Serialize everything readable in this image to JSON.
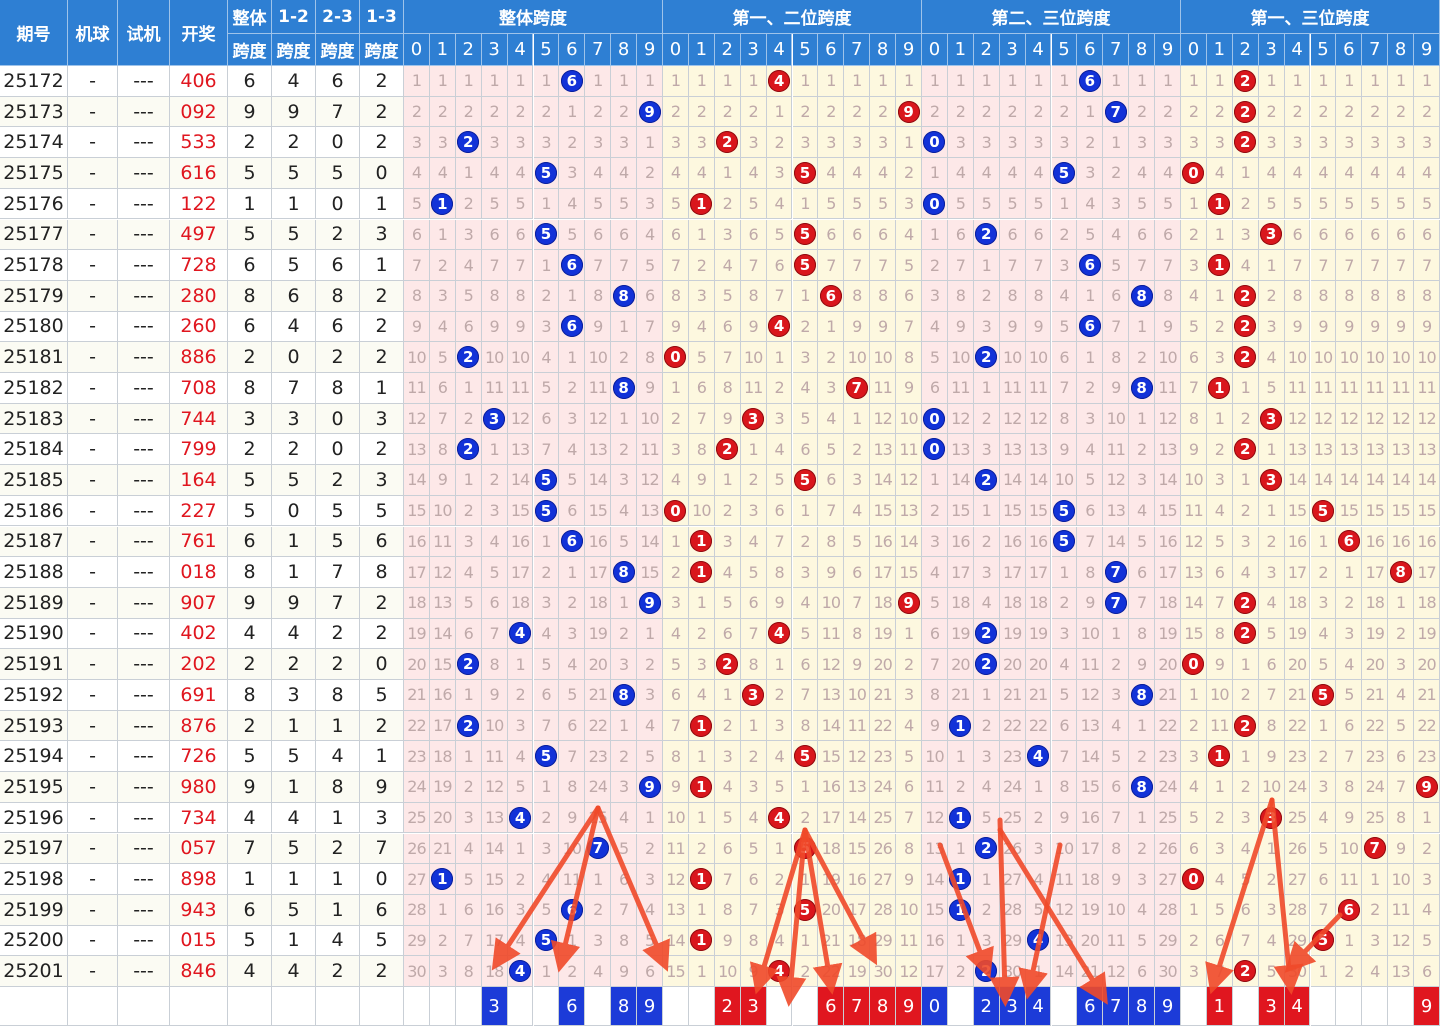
{
  "headers": {
    "issue": "期号",
    "machine": "机球",
    "trial": "试机",
    "draw": "开奖",
    "span_all": [
      "整体",
      "跨度"
    ],
    "span_12": [
      "1-2",
      "跨度"
    ],
    "span_23": [
      "2-3",
      "跨度"
    ],
    "span_13": [
      "1-3",
      "跨度"
    ],
    "groups": [
      "整体跨度",
      "第一、二位跨度",
      "第二、三位跨度",
      "第一、三位跨度"
    ],
    "digits": [
      "0",
      "1",
      "2",
      "3",
      "4",
      "5",
      "6",
      "7",
      "8",
      "9"
    ]
  },
  "colors": {
    "blue": "#1232d8",
    "red": "#d9161c",
    "header": "#2e7fd3",
    "arrow": "#f04a2a"
  },
  "chart_data": {
    "type": "table",
    "rows": [
      {
        "issue": "25172",
        "machine": "-",
        "trial": "---",
        "draw": "406",
        "span_all": 6,
        "span_12": 4,
        "span_23": 6,
        "span_13": 2
      },
      {
        "issue": "25173",
        "machine": "-",
        "trial": "---",
        "draw": "092",
        "span_all": 9,
        "span_12": 9,
        "span_23": 7,
        "span_13": 2
      },
      {
        "issue": "25174",
        "machine": "-",
        "trial": "---",
        "draw": "533",
        "span_all": 2,
        "span_12": 2,
        "span_23": 0,
        "span_13": 2
      },
      {
        "issue": "25175",
        "machine": "-",
        "trial": "---",
        "draw": "616",
        "span_all": 5,
        "span_12": 5,
        "span_23": 5,
        "span_13": 0
      },
      {
        "issue": "25176",
        "machine": "-",
        "trial": "---",
        "draw": "122",
        "span_all": 1,
        "span_12": 1,
        "span_23": 0,
        "span_13": 1
      },
      {
        "issue": "25177",
        "machine": "-",
        "trial": "---",
        "draw": "497",
        "span_all": 5,
        "span_12": 5,
        "span_23": 2,
        "span_13": 3
      },
      {
        "issue": "25178",
        "machine": "-",
        "trial": "---",
        "draw": "728",
        "span_all": 6,
        "span_12": 5,
        "span_23": 6,
        "span_13": 1
      },
      {
        "issue": "25179",
        "machine": "-",
        "trial": "---",
        "draw": "280",
        "span_all": 8,
        "span_12": 6,
        "span_23": 8,
        "span_13": 2
      },
      {
        "issue": "25180",
        "machine": "-",
        "trial": "---",
        "draw": "260",
        "span_all": 6,
        "span_12": 4,
        "span_23": 6,
        "span_13": 2
      },
      {
        "issue": "25181",
        "machine": "-",
        "trial": "---",
        "draw": "886",
        "span_all": 2,
        "span_12": 0,
        "span_23": 2,
        "span_13": 2
      },
      {
        "issue": "25182",
        "machine": "-",
        "trial": "---",
        "draw": "708",
        "span_all": 8,
        "span_12": 7,
        "span_23": 8,
        "span_13": 1
      },
      {
        "issue": "25183",
        "machine": "-",
        "trial": "---",
        "draw": "744",
        "span_all": 3,
        "span_12": 3,
        "span_23": 0,
        "span_13": 3
      },
      {
        "issue": "25184",
        "machine": "-",
        "trial": "---",
        "draw": "799",
        "span_all": 2,
        "span_12": 2,
        "span_23": 0,
        "span_13": 2
      },
      {
        "issue": "25185",
        "machine": "-",
        "trial": "---",
        "draw": "164",
        "span_all": 5,
        "span_12": 5,
        "span_23": 2,
        "span_13": 3
      },
      {
        "issue": "25186",
        "machine": "-",
        "trial": "---",
        "draw": "227",
        "span_all": 5,
        "span_12": 0,
        "span_23": 5,
        "span_13": 5
      },
      {
        "issue": "25187",
        "machine": "-",
        "trial": "---",
        "draw": "761",
        "span_all": 6,
        "span_12": 1,
        "span_23": 5,
        "span_13": 6
      },
      {
        "issue": "25188",
        "machine": "-",
        "trial": "---",
        "draw": "018",
        "span_all": 8,
        "span_12": 1,
        "span_23": 7,
        "span_13": 8
      },
      {
        "issue": "25189",
        "machine": "-",
        "trial": "---",
        "draw": "907",
        "span_all": 9,
        "span_12": 9,
        "span_23": 7,
        "span_13": 2
      },
      {
        "issue": "25190",
        "machine": "-",
        "trial": "---",
        "draw": "402",
        "span_all": 4,
        "span_12": 4,
        "span_23": 2,
        "span_13": 2
      },
      {
        "issue": "25191",
        "machine": "-",
        "trial": "---",
        "draw": "202",
        "span_all": 2,
        "span_12": 2,
        "span_23": 2,
        "span_13": 0
      },
      {
        "issue": "25192",
        "machine": "-",
        "trial": "---",
        "draw": "691",
        "span_all": 8,
        "span_12": 3,
        "span_23": 8,
        "span_13": 5
      },
      {
        "issue": "25193",
        "machine": "-",
        "trial": "---",
        "draw": "876",
        "span_all": 2,
        "span_12": 1,
        "span_23": 1,
        "span_13": 2
      },
      {
        "issue": "25194",
        "machine": "-",
        "trial": "---",
        "draw": "726",
        "span_all": 5,
        "span_12": 5,
        "span_23": 4,
        "span_13": 1
      },
      {
        "issue": "25195",
        "machine": "-",
        "trial": "---",
        "draw": "980",
        "span_all": 9,
        "span_12": 1,
        "span_23": 8,
        "span_13": 9
      },
      {
        "issue": "25196",
        "machine": "-",
        "trial": "---",
        "draw": "734",
        "span_all": 4,
        "span_12": 4,
        "span_23": 1,
        "span_13": 3
      },
      {
        "issue": "25197",
        "machine": "-",
        "trial": "---",
        "draw": "057",
        "span_all": 7,
        "span_12": 5,
        "span_23": 2,
        "span_13": 7
      },
      {
        "issue": "25198",
        "machine": "-",
        "trial": "---",
        "draw": "898",
        "span_all": 1,
        "span_12": 1,
        "span_23": 1,
        "span_13": 0
      },
      {
        "issue": "25199",
        "machine": "-",
        "trial": "---",
        "draw": "943",
        "span_all": 6,
        "span_12": 5,
        "span_23": 1,
        "span_13": 6
      },
      {
        "issue": "25200",
        "machine": "-",
        "trial": "---",
        "draw": "015",
        "span_all": 5,
        "span_12": 1,
        "span_23": 4,
        "span_13": 5
      },
      {
        "issue": "25201",
        "machine": "-",
        "trial": "---",
        "draw": "846",
        "span_all": 4,
        "span_12": 4,
        "span_23": 2,
        "span_13": 2
      }
    ],
    "predictions": {
      "span_all": [
        3,
        6,
        8,
        9
      ],
      "span_12": [
        2,
        3,
        6,
        7,
        8,
        9
      ],
      "span_23": [
        0,
        2,
        3,
        4,
        6,
        7,
        8,
        9
      ],
      "span_13": [
        1,
        3,
        4,
        9
      ]
    }
  }
}
